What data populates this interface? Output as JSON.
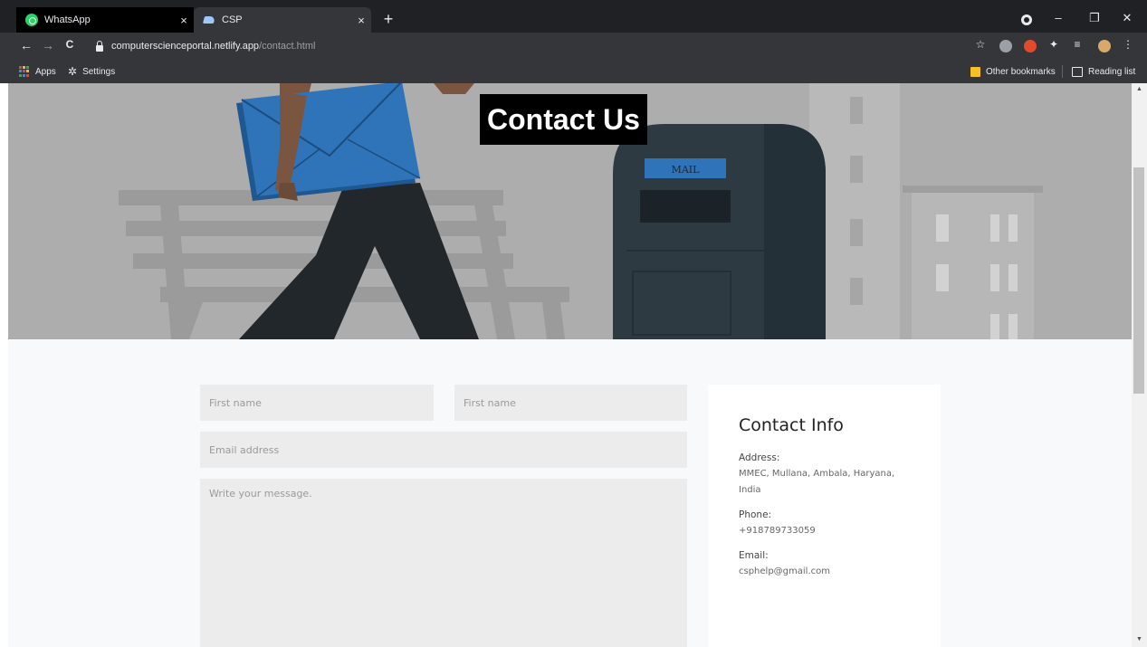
{
  "browser": {
    "tabs": [
      {
        "title": "WhatsApp",
        "close": "×"
      },
      {
        "title": "CSP",
        "close": "×"
      }
    ],
    "new_tab": "+",
    "window_controls": {
      "minimize": "–",
      "restore": "❐",
      "close": "✕"
    },
    "nav": {
      "back": "←",
      "forward": "→",
      "reload": "C"
    },
    "url_host": "computerscienceportal.netlify.app",
    "url_path": "/contact.html",
    "bookmarks": {
      "apps": "Apps",
      "settings": "Settings",
      "other_bookmarks": "Other bookmarks",
      "reading_list": "Reading list"
    }
  },
  "hero": {
    "title": "Contact Us",
    "mailbox_label": "MAIL"
  },
  "form": {
    "first_name_placeholder": "First name",
    "second_name_placeholder": "First name",
    "email_placeholder": "Email address",
    "message_placeholder": "Write your message."
  },
  "contact_info": {
    "title": "Contact Info",
    "address_label": "Address:",
    "address_line1": "MMEC, Mullana, Ambala, Haryana,",
    "address_line2": "India",
    "phone_label": "Phone:",
    "phone": "+918789733059",
    "email_label": "Email:",
    "email": "csphelp@gmail.com"
  },
  "colors": {
    "chrome_bg": "#202124",
    "toolbar_bg": "#35363a",
    "hero_bg": "#adadad",
    "envelope": "#2f73b9",
    "mailbox": "#2e3a42",
    "field_bg": "#ececec"
  }
}
